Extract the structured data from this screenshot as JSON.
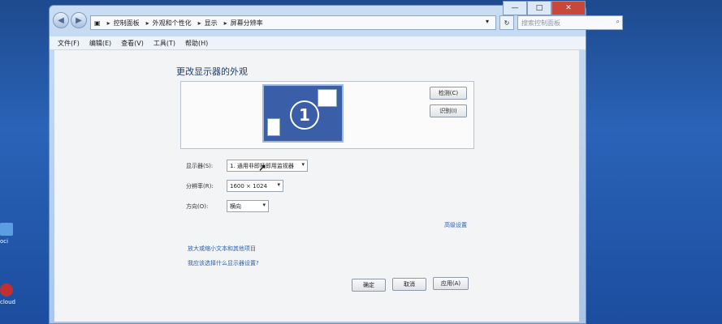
{
  "desktop": {
    "icon1_label": "oci",
    "icon2_label": "cloud"
  },
  "window": {
    "breadcrumb": [
      "控制面板",
      "外观和个性化",
      "显示",
      "屏幕分辨率"
    ],
    "search_placeholder": "搜索控制面板",
    "controls": {
      "minimize": "—",
      "maximize": "□",
      "close": "✕"
    }
  },
  "menu": [
    "文件(F)",
    "编辑(E)",
    "查看(V)",
    "工具(T)",
    "帮助(H)"
  ],
  "page": {
    "title": "更改显示器的外观",
    "monitor_number": "1",
    "detect_button": "检测(C)",
    "identify_button": "识别(I)",
    "display_label": "显示器(S):",
    "display_value": "1. 通用非即插即用监视器",
    "resolution_label": "分辨率(R):",
    "resolution_value": "1600 × 1024",
    "orientation_label": "方向(O):",
    "orientation_value": "横向",
    "advanced_link": "高级设置",
    "link1": "放大或缩小文本和其他项目",
    "link2": "我应该选择什么显示器设置?",
    "ok_button": "确定",
    "cancel_button": "取消",
    "apply_button": "应用(A)"
  }
}
